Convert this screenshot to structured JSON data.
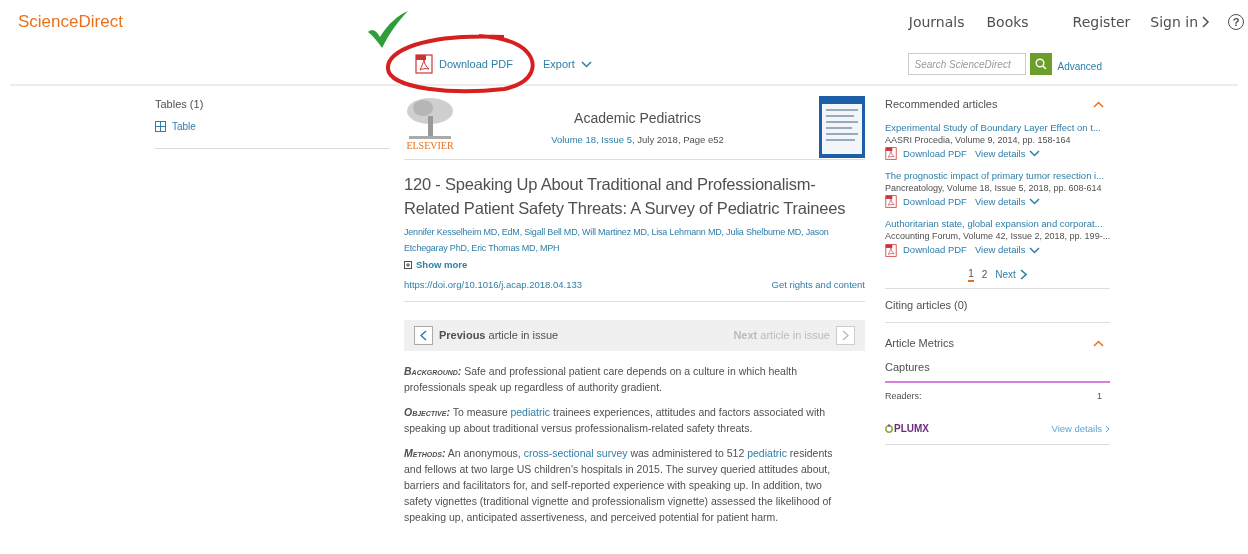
{
  "header": {
    "logo": "ScienceDirect",
    "nav": [
      "Journals",
      "Books"
    ],
    "account": [
      "Register",
      "Sign in"
    ],
    "help": "?"
  },
  "toolbar": {
    "download": "Download PDF",
    "export": "Export",
    "search": {
      "placeholder": "Search ScienceDirect"
    },
    "advanced": "Advanced"
  },
  "outline": {
    "heading": "Tables (1)",
    "items": [
      "Table"
    ]
  },
  "journal": {
    "publisher": "ELSEVIER",
    "name": "Academic Pediatrics",
    "issue_link": "Volume 18, Issue 5",
    "issue_rest": ", July 2018, Page e52"
  },
  "article": {
    "title": "120 - Speaking Up About Traditional and Professionalism-Related Patient Safety Threats: A Survey of Pediatric Trainees",
    "authors": "Jennifer Kesselheim MD, EdM, Sigall Bell MD, Will Martinez MD, Lisa Lehmann MD, Julia Shelburne MD, Jason Etchegaray PhD, Eric Thomas MD, MPH",
    "show_more": "Show more",
    "doi": "https://doi.org/10.1016/j.acap.2018.04.133",
    "rights": "Get rights and content"
  },
  "issue_nav": [
    {
      "kind": "previous",
      "label": "**Previous** article in issue",
      "disabled": false
    },
    {
      "kind": "next",
      "label": "**Next** article in issue",
      "disabled": true
    }
  ],
  "abstract": [
    {
      "label": "Background:",
      "segments": [
        {
          "text": "Safe and professional patient care depends on a culture in which health professionals speak up regardless of authority gradient.",
          "kind": "text"
        }
      ]
    },
    {
      "label": "Objective:",
      "segments": [
        {
          "text": "To measure ",
          "kind": "text"
        },
        {
          "text": "pediatric",
          "kind": "link"
        },
        {
          "text": " trainees experiences, attitudes and factors associated with speaking up about traditional versus professionalism-related safety threats.",
          "kind": "text"
        }
      ]
    },
    {
      "label": "Methods:",
      "segments": [
        {
          "text": "An anonymous, ",
          "kind": "text"
        },
        {
          "text": "cross-sectional survey",
          "kind": "link"
        },
        {
          "text": " was administered to 512 ",
          "kind": "text"
        },
        {
          "text": "pediatric",
          "kind": "link"
        },
        {
          "text": " residents and fellows at two large US children's hospitals in 2015. The survey queried attitudes about, barriers and facilitators for, and self-reported experience with speaking up. In addition, two safety vignettes (traditional vignette and professionalism vignette) assessed the likelihood of speaking up, anticipated assertiveness, and perceived potential for patient harm.",
          "kind": "text"
        }
      ]
    }
  ],
  "recommended": {
    "heading": "Recommended articles",
    "expanded": true,
    "items": [
      {
        "title": "Experimental Study of Boundary Layer Effect on t...",
        "source": "AASRI Procedia, Volume 9, 2014, pp. 158-164",
        "download": "Download PDF",
        "details": "View details"
      },
      {
        "title": "The prognostic impact of primary tumor resection i...",
        "source": "Pancreatology, Volume 18, Issue 5, 2018, pp. 608-614",
        "download": "Download PDF",
        "details": "View details"
      },
      {
        "title": "Authoritarian state, global expansion and corporat...",
        "source": "Accounting Forum, Volume 42, Issue 2, 2018, pp. 199-...",
        "download": "Download PDF",
        "details": "View details"
      }
    ],
    "pages": [
      {
        "label": "1",
        "selected": true
      },
      {
        "label": "2",
        "selected": false
      }
    ],
    "next": "Next"
  },
  "citing": {
    "heading": "Citing articles (0)"
  },
  "metrics": {
    "heading": "Article Metrics",
    "expanded": true,
    "tab": "Captures",
    "label": "Readers:",
    "value": "1",
    "brand": "PLUMX",
    "details": "View details"
  }
}
